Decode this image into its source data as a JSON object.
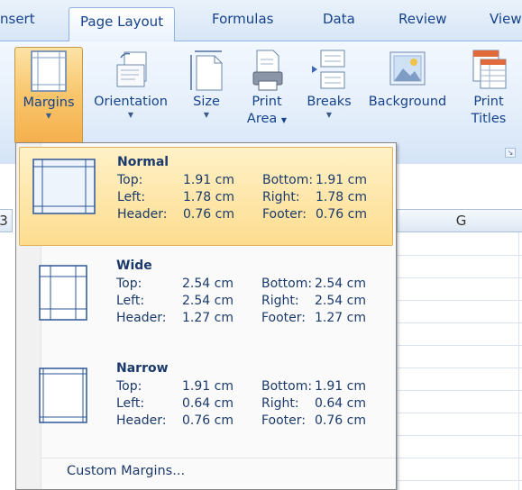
{
  "tabs": [
    {
      "label": "nsert"
    },
    {
      "label": "Page Layout"
    },
    {
      "label": "Formulas"
    },
    {
      "label": "Data"
    },
    {
      "label": "Review"
    },
    {
      "label": "View"
    }
  ],
  "ribbon": {
    "margins": {
      "label": "Margins",
      "icon": "margins-icon"
    },
    "orientation": {
      "label": "Orientation",
      "icon": "orientation-icon"
    },
    "size": {
      "label": "Size",
      "icon": "size-icon"
    },
    "print_area": {
      "label1": "Print",
      "label2": "Area",
      "icon": "print-area-icon"
    },
    "breaks": {
      "label": "Breaks",
      "icon": "breaks-icon"
    },
    "background": {
      "label": "Background",
      "icon": "background-icon"
    },
    "print_titles": {
      "label1": "Print",
      "label2": "Titles",
      "icon": "print-titles-icon"
    }
  },
  "sheet": {
    "column_header_g": "G",
    "column_header_left": "3"
  },
  "margins_menu": {
    "presets": [
      {
        "name": "Normal",
        "selected": true,
        "top_label": "Top:",
        "top": "1.91 cm",
        "bottom_label": "Bottom:",
        "bottom": "1.91 cm",
        "left_label": "Left:",
        "left": "1.78 cm",
        "right_label": "Right:",
        "right": "1.78 cm",
        "header_label": "Header:",
        "header": "0.76 cm",
        "footer_label": "Footer:",
        "footer": "0.76 cm"
      },
      {
        "name": "Wide",
        "selected": false,
        "top_label": "Top:",
        "top": "2.54 cm",
        "bottom_label": "Bottom:",
        "bottom": "2.54 cm",
        "left_label": "Left:",
        "left": "2.54 cm",
        "right_label": "Right:",
        "right": "2.54 cm",
        "header_label": "Header:",
        "header": "1.27 cm",
        "footer_label": "Footer:",
        "footer": "1.27 cm"
      },
      {
        "name": "Narrow",
        "selected": false,
        "top_label": "Top:",
        "top": "1.91 cm",
        "bottom_label": "Bottom:",
        "bottom": "1.91 cm",
        "left_label": "Left:",
        "left": "0.64 cm",
        "right_label": "Right:",
        "right": "0.64 cm",
        "header_label": "Header:",
        "header": "0.76 cm",
        "footer_label": "Footer:",
        "footer": "0.76 cm"
      }
    ],
    "custom_margins": "Custom Margins..."
  },
  "colors": {
    "accent": "#15428b",
    "selected_bg": "#fddd8f",
    "ribbon_bg": "#dfeaf7"
  }
}
